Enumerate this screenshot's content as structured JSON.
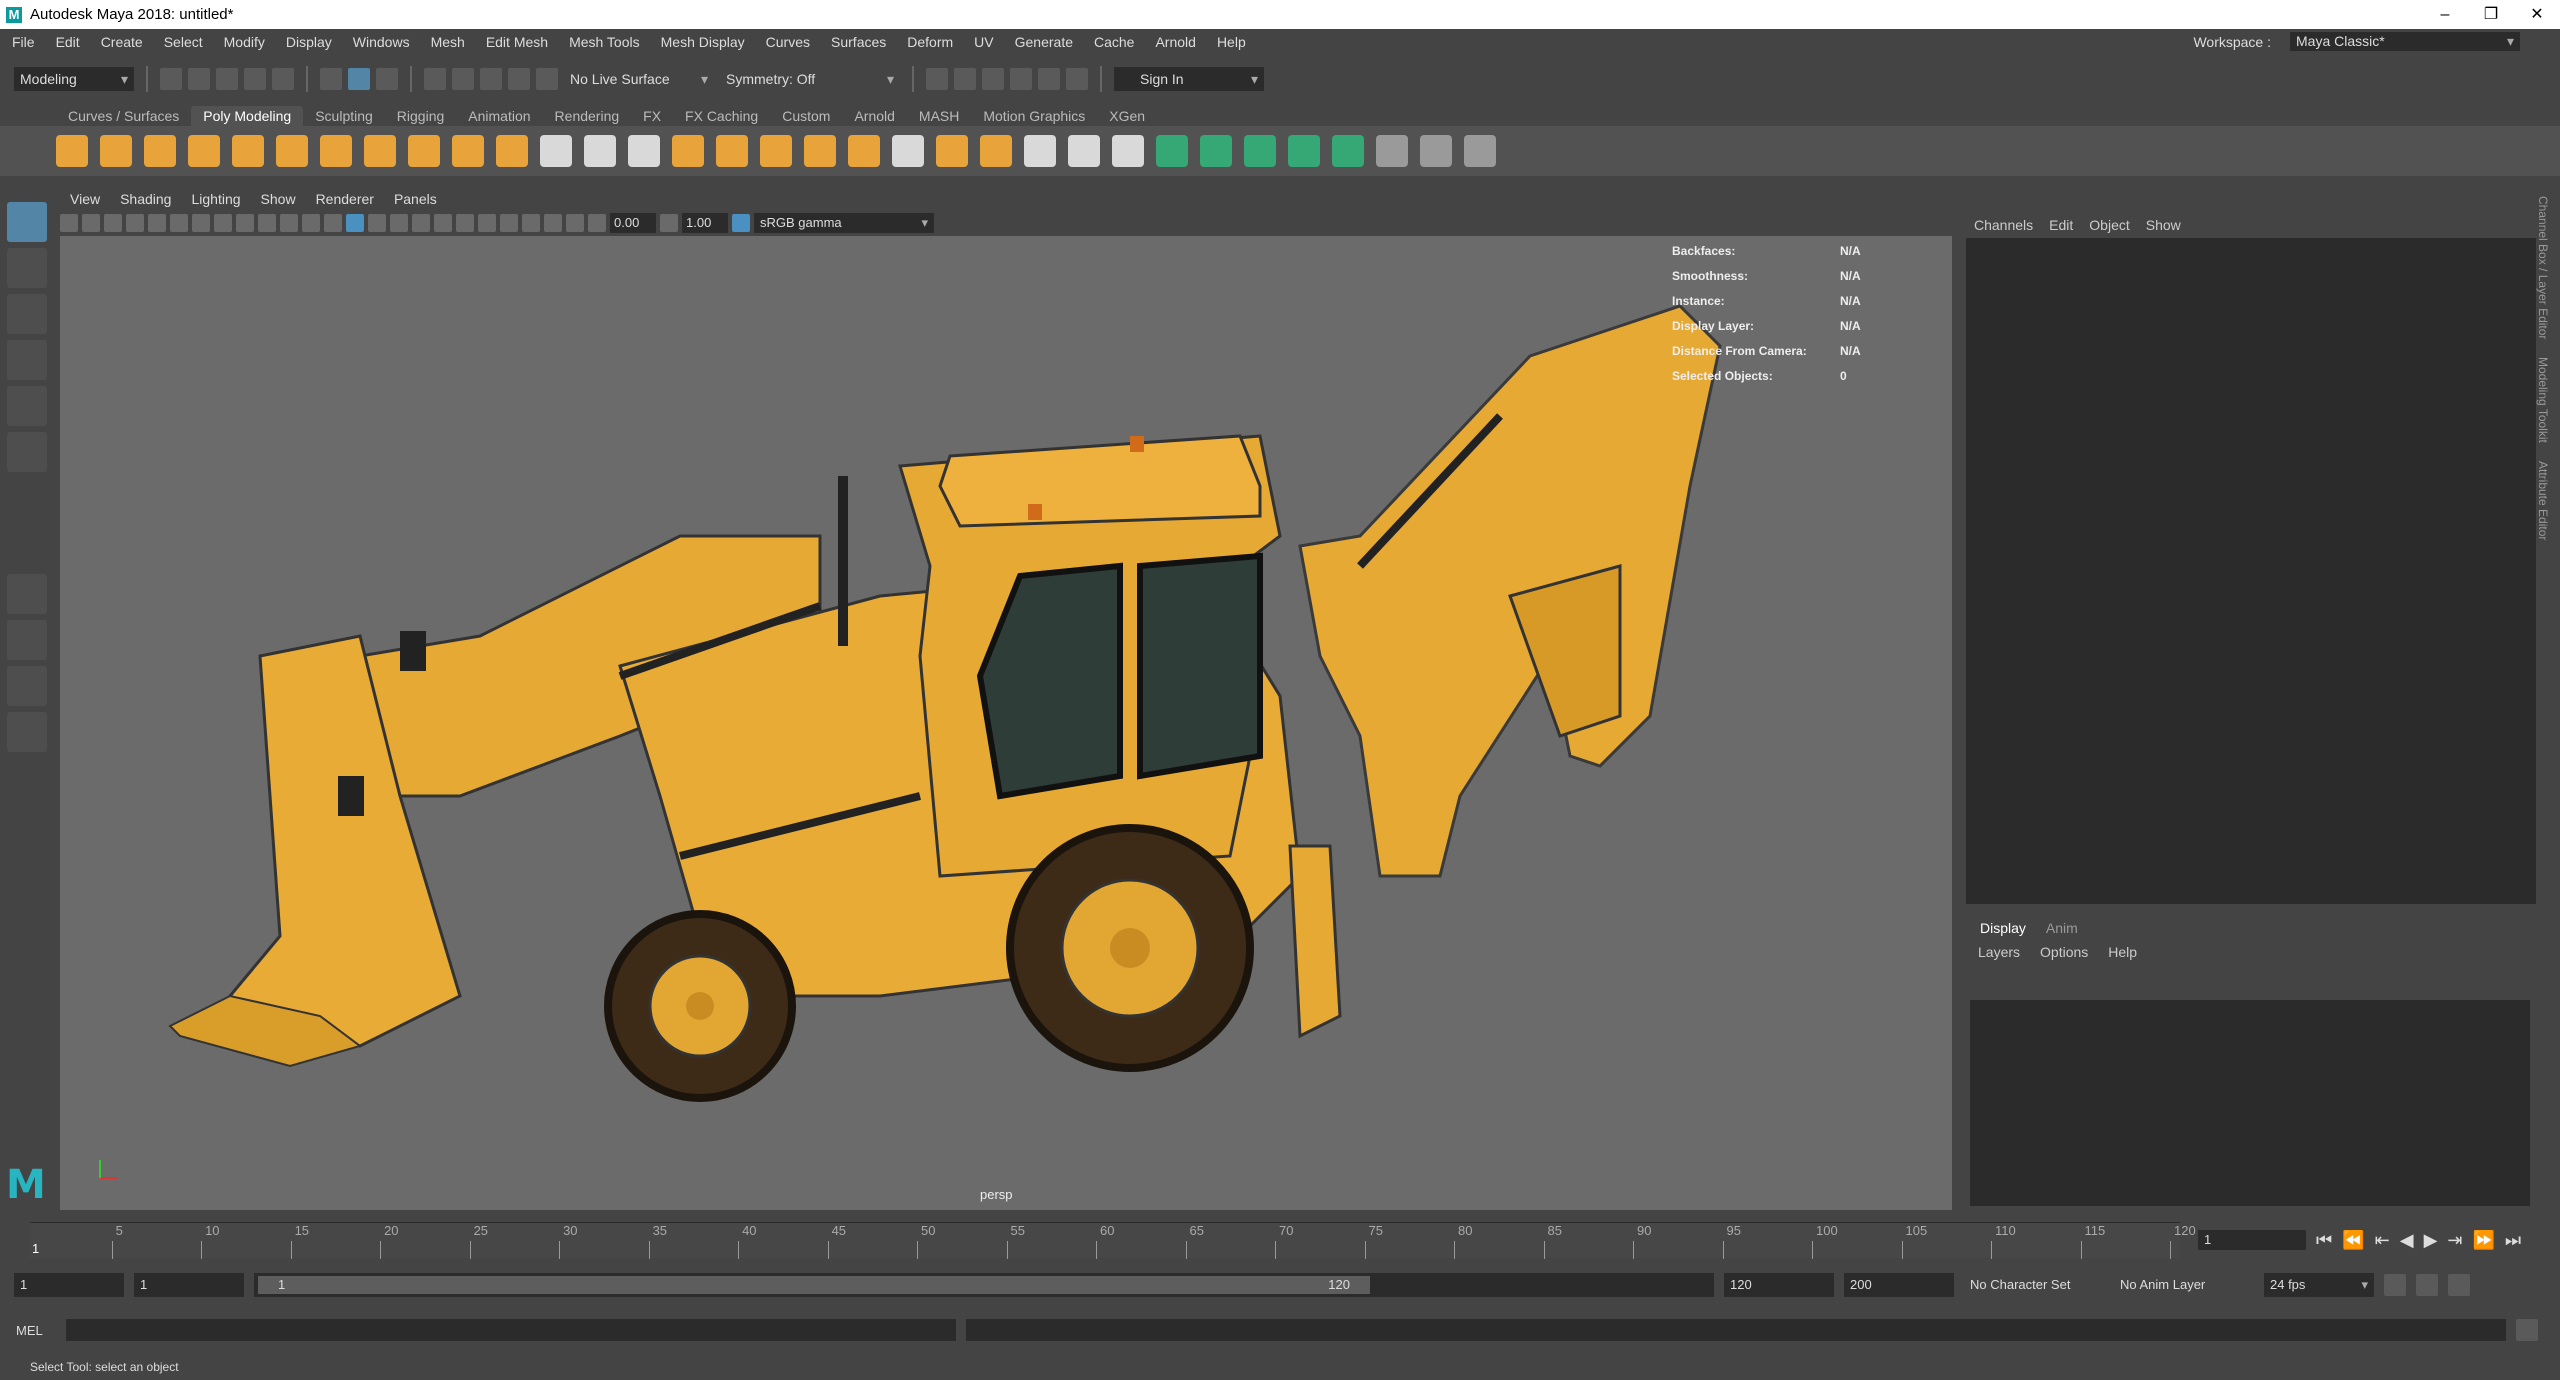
{
  "window": {
    "title": "Autodesk Maya 2018: untitled*",
    "minimize": "–",
    "restore": "❐",
    "close": "✕"
  },
  "menu": [
    "File",
    "Edit",
    "Create",
    "Select",
    "Modify",
    "Display",
    "Windows",
    "Mesh",
    "Edit Mesh",
    "Mesh Tools",
    "Mesh Display",
    "Curves",
    "Surfaces",
    "Deform",
    "UV",
    "Generate",
    "Cache",
    "Arnold",
    "Help"
  ],
  "workspace": {
    "label": "Workspace :",
    "value": "Maya Classic*"
  },
  "status": {
    "mode": "Modeling",
    "live_surface": "No Live Surface",
    "symmetry": "Symmetry: Off",
    "sign_in": "Sign In"
  },
  "shelf_tabs": [
    "Curves / Surfaces",
    "Poly Modeling",
    "Sculpting",
    "Rigging",
    "Animation",
    "Rendering",
    "FX",
    "FX Caching",
    "Custom",
    "Arnold",
    "MASH",
    "Motion Graphics",
    "XGen"
  ],
  "shelf_active": "Poly Modeling",
  "viewport": {
    "menu": [
      "View",
      "Shading",
      "Lighting",
      "Show",
      "Renderer",
      "Panels"
    ],
    "exposure": "0.00",
    "gamma": "1.00",
    "colorspace": "sRGB gamma",
    "camera": "persp",
    "hud": [
      {
        "k": "Backfaces:",
        "v": "N/A"
      },
      {
        "k": "Smoothness:",
        "v": "N/A"
      },
      {
        "k": "Instance:",
        "v": "N/A"
      },
      {
        "k": "Display Layer:",
        "v": "N/A"
      },
      {
        "k": "Distance From Camera:",
        "v": "N/A"
      },
      {
        "k": "Selected Objects:",
        "v": "0"
      }
    ]
  },
  "channel_box": {
    "menu": [
      "Channels",
      "Edit",
      "Object",
      "Show"
    ]
  },
  "layer_editor": {
    "tabs": [
      "Display",
      "Anim"
    ],
    "menu": [
      "Layers",
      "Options",
      "Help"
    ]
  },
  "side_tabs": [
    "Channel Box / Layer Editor",
    "Modeling Toolkit",
    "Attribute Editor"
  ],
  "timeline": {
    "ticks": [
      "5",
      "10",
      "15",
      "20",
      "25",
      "30",
      "35",
      "40",
      "45",
      "50",
      "55",
      "60",
      "65",
      "70",
      "75",
      "80",
      "85",
      "90",
      "95",
      "100",
      "105",
      "110",
      "115",
      "120"
    ],
    "start_label": "1",
    "current_frame": "1"
  },
  "range": {
    "start": "1",
    "playback_start": "1",
    "slider_start": "1",
    "slider_end": "120",
    "playback_end": "120",
    "end": "200",
    "character_set": "No Character Set",
    "anim_layer": "No Anim Layer",
    "fps": "24 fps"
  },
  "command": {
    "label": "MEL"
  },
  "help_line": "Select Tool: select an object"
}
